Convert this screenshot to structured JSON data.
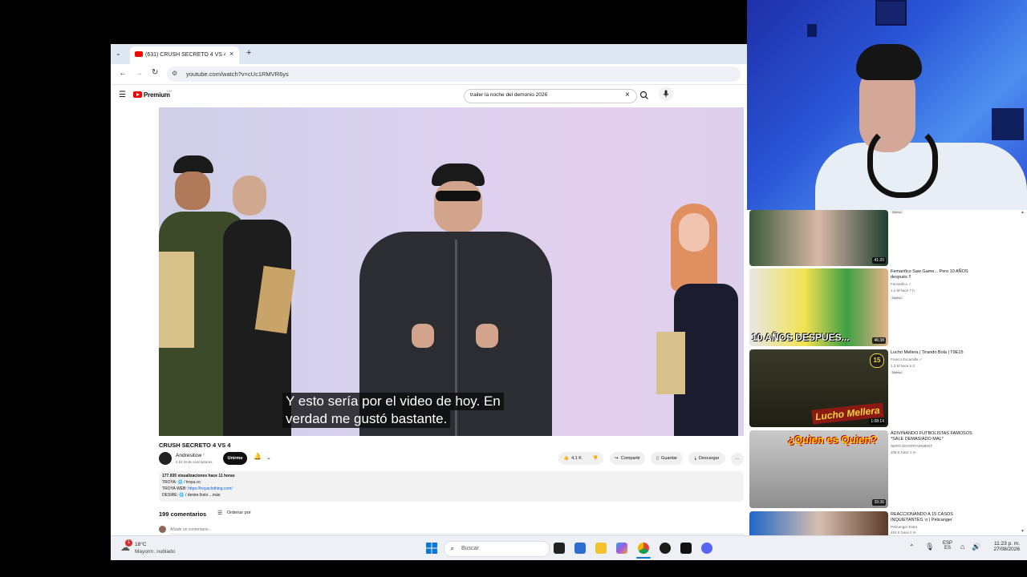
{
  "browser": {
    "tab_title": "(631) CRUSH SECRETO 4 VS 4 ·",
    "url": "youtube.com/watch?v=cUc1RMVR6ys",
    "new_tab_symbol": "+",
    "close_tab_symbol": "×"
  },
  "youtube": {
    "logo_text": "Premium",
    "logo_sup": "CO",
    "search_value": "trailer la noche del demonio 2026",
    "caption_line1": "Y esto sería por el video de hoy. En",
    "caption_line2": "verdad me gustó bastante.",
    "video_title": "CRUSH SECRETO 4 VS 4",
    "channel_name": "Andresitow",
    "subscribers": "2,61 M de suscriptores",
    "join_label": "Unirme",
    "like_count": "4,1 K",
    "share_label": "Compartir",
    "save_label": "Guardar",
    "download_label": "Descargar",
    "more_label": "···",
    "description": {
      "stats": "177.935 visualizaciones  hace 11 horas",
      "line1": "TROYA:  🌐 / troya.co",
      "line2_prefix": "TROYA WEB: ",
      "line2_link": "https://troyaclothing.com/",
      "line3": "DESIRE:  🌐 / desire.fxsto    ...más"
    },
    "comments_count": "199 comentarios",
    "sort_label": "Ordenar por",
    "add_comment_placeholder": "Añade un comentario..."
  },
  "sidebar": {
    "items": [
      {
        "title": "",
        "meta1": "",
        "meta2": "",
        "badge": "Nuevo",
        "duration": "41:20"
      },
      {
        "title": "Femanfico Saw Game... Pero 10 AÑOS después !!",
        "meta1": "Femanfico ✓",
        "meta2": "1,1 M  hace 7 h",
        "badge": "Nuevo",
        "duration": "46:38",
        "thumb_text": "10 AÑOS DESPUES..."
      },
      {
        "title": "Lucho Mellera | Tirando Bola | T9E15",
        "meta1": "Franco Escamilla ✓",
        "meta2": "1,3 M  hace 5 d",
        "badge": "Nuevo",
        "duration": "1:08:14",
        "thumb_text": "Lucho Mellera",
        "thumb_num": "15"
      },
      {
        "title": "ADIVINANDO FUTBOLISTAS FAMOSOS *SALE DEMASIADO MAL*",
        "meta1": "NERO ENTERTAINMENT",
        "meta2": "108 K  hace 1 m",
        "badge": "",
        "duration": "39:36",
        "thumb_text": "¿Quien es Quien?"
      },
      {
        "title": "REACCIONANDO A 15 CASOS INQUIETANTES :o | Pelicanger",
        "meta1": "Pelicanger Extra",
        "meta2": "481 K  hace 2 m",
        "badge": "",
        "duration": ""
      }
    ]
  },
  "taskbar": {
    "weather_temp": "18°C",
    "weather_desc": "Mayorm. nublado",
    "weather_badge": "1",
    "search_placeholder": "Buscar",
    "lang_top": "ESP",
    "lang_bottom": "ES",
    "time": "11:23 p. m.",
    "date": "27/08/2026"
  },
  "colors": {
    "yt_red": "#ff0000",
    "taskbar_bg": "#eef0f5",
    "tabbar_bg": "#dfe7f3"
  }
}
